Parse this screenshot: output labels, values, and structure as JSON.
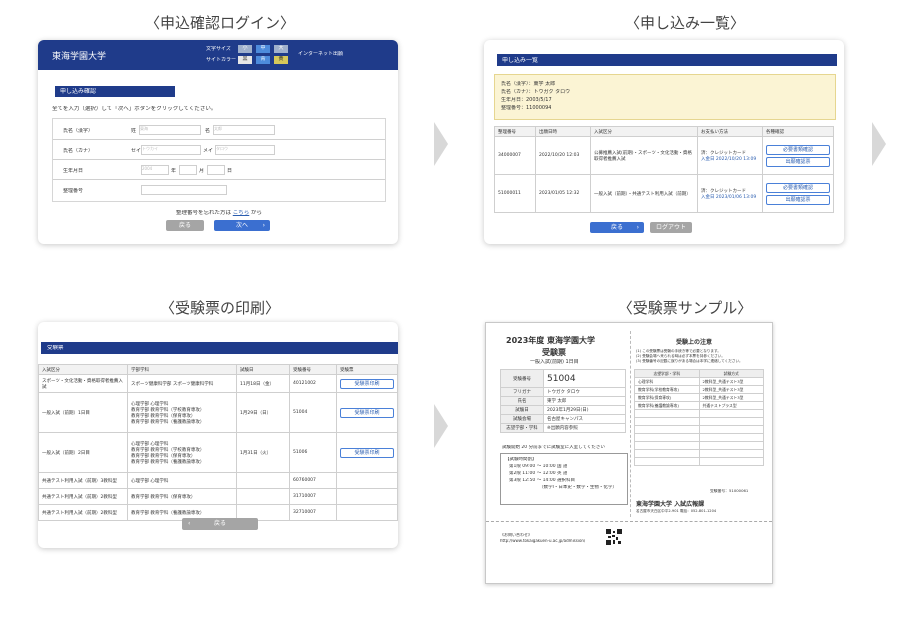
{
  "headings": {
    "login": "〈申込確認ログイン〉",
    "list": "〈申し込み一覧〉",
    "print": "〈受験票の印刷〉",
    "sample": "〈受験票サンプル〉"
  },
  "login": {
    "university": "東海学園大学",
    "font_label": "文字サイズ",
    "font_sizes": [
      "小",
      "中",
      "大"
    ],
    "site_label": "サイトカラー",
    "colors": [
      "黒",
      "青",
      "黄"
    ],
    "net_label": "インターネット出願",
    "section_title": "申し込み確認",
    "instruction": "全てを入力（選択）して「次へ」ボタンをクリックしてください。",
    "fields": [
      {
        "label": "氏名（漢字）",
        "sub1": "姓",
        "ph1": "東海",
        "sub2": "名",
        "ph2": "太郎"
      },
      {
        "label": "氏名（カナ）",
        "sub1": "セイ",
        "ph1": "トウカイ",
        "sub2": "メイ",
        "ph2": "タロウ"
      },
      {
        "label": "生年月日",
        "year": "2004",
        "y": "年",
        "m": "月",
        "d": "日"
      },
      {
        "label": "整理番号"
      }
    ],
    "forgot": "整理番号を忘れた方は",
    "forgot_link": "こちら",
    "forgot_tail": "から",
    "back_button": "戻る",
    "next_button": "次へ"
  },
  "list": {
    "title": "申し込み一覧",
    "info": [
      "氏名（漢字）：東学 太郎",
      "氏名（カナ）：トウガク タロウ",
      "生年月日：2003/5/17",
      "整理番号：11000094"
    ],
    "columns": [
      "整理番号",
      "出願日時",
      "入試区分",
      "お支払い方法",
      "各種確認"
    ],
    "rows": [
      {
        "no": "34000007",
        "date": "2022/10/20 12:03",
        "exam": "公募推薦入試(前期)・スポーツ・文化活動・資格取得者推薦入試",
        "pay1": "済：クレジットカード",
        "pay2": "入金日 2022/10/20 13:09",
        "b1": "必要書類確認",
        "b2": "出願確認票"
      },
      {
        "no": "51000011",
        "date": "2023/01/05 12:32",
        "exam": "一般入試（前期）・共通テスト利用入試（前期）",
        "pay1": "済：クレジットカード",
        "pay2": "入金日 2023/01/06 13:09",
        "b1": "必要書類確認",
        "b2": "出願確認票"
      }
    ],
    "back_button": "戻る",
    "logout_button": "ログアウト"
  },
  "print": {
    "title": "受験票",
    "columns": [
      "入試区分",
      "学部学科",
      "試験日",
      "受験番号",
      "受験票"
    ],
    "rows": [
      {
        "exam": "スポーツ・文化活動・資格取得者推薦入試",
        "dept": "スポーツ健康科学部 スポーツ健康科学科",
        "date": "11月18日（金）",
        "num": "40121002",
        "btn": "受験票印刷"
      },
      {
        "exam": "一般入試（前期）1日目",
        "dept": "心理学部 心理学科\n教育学部 教育学科（学校教育専攻）\n教育学部 教育学科（保育専攻）\n教育学部 教育学科（養護教諭専攻）",
        "date": "1月29日（日）",
        "num": "51004",
        "btn": "受験票印刷"
      },
      {
        "exam": "一般入試（前期）2日目",
        "dept": "心理学部 心理学科\n教育学部 教育学科（学校教育専攻）\n教育学部 教育学科（保育専攻）\n教育学部 教育学科（養護教諭専攻）",
        "date": "1月31日（火）",
        "num": "51006",
        "btn": "受験票印刷"
      },
      {
        "exam": "共通テスト利用入試（前期）3教科型",
        "dept": "心理学部 心理学科",
        "date": "",
        "num": "60760007",
        "btn": ""
      },
      {
        "exam": "共通テスト利用入試（前期）2教科型",
        "dept": "教育学部 教育学科（保育専攻）",
        "date": "",
        "num": "31710007",
        "btn": ""
      },
      {
        "exam": "共通テスト利用入試（前期）2教科型",
        "dept": "教育学部 教育学科（養護教諭専攻）",
        "date": "",
        "num": "32710007",
        "btn": ""
      }
    ],
    "back_button": "戻る"
  },
  "sample": {
    "year_title": "2023年度 東海学園大学",
    "ticket": "受験票",
    "subtitle": "一般入試(前期) 1日目",
    "rows": [
      {
        "label": "受験番号",
        "value": "51004"
      },
      {
        "label": "フリガナ",
        "value": "トウガク タロウ"
      },
      {
        "label": "氏名",
        "value": "東学 太郎"
      },
      {
        "label": "試験日",
        "value": "2023年1月29日(日)"
      },
      {
        "label": "試験会場",
        "value": "名古屋キャンパス"
      },
      {
        "label": "志望学部・学科",
        "value": "※出願内容参照"
      }
    ],
    "notice": "試験開始 20 分前までに試験室に入室してください",
    "schedule_title": "【試験時間割】",
    "schedule": [
      "第1限 09:00 〜 10:00 国 語",
      "第2限 11:00 〜 12:00 英 語",
      "第3限 12:50 〜 14:00 選択科目"
    ],
    "schedule_note": "（数学Ⅰ・日本史・数学・生物・化学）",
    "attention_title": "受験上の注意",
    "attention": [
      "(1) この受験票は受験の手続き等で必要となります。",
      "(2) 受験会場へ来られる時は必ず本票を持参ください。",
      "(3) 受験番号の記載に誤りがある場合は本学に連絡してください。"
    ],
    "table_headers": [
      "志望学部・学科",
      "試験方式"
    ],
    "table_rows": [
      [
        "心理学科",
        "2教科型_共通テスト3型"
      ],
      [
        "教育学科(学校教育専攻)",
        "2教科型_共通テスト3型"
      ],
      [
        "教育学科(保育専攻)",
        "2教科型_共通テスト3型"
      ],
      [
        "教育学科(養護教諭専攻)",
        "共通テストプラス型"
      ]
    ],
    "ticket_no": "受験番号：51000061",
    "office": "東海学園大学 入試広報課",
    "address": "名古屋市天白区中平2-901 電話：052-801-1204",
    "url_label": "《お問い合わせ》",
    "url": "http://www.tokaigakuen-u.ac.jp/admission/"
  }
}
